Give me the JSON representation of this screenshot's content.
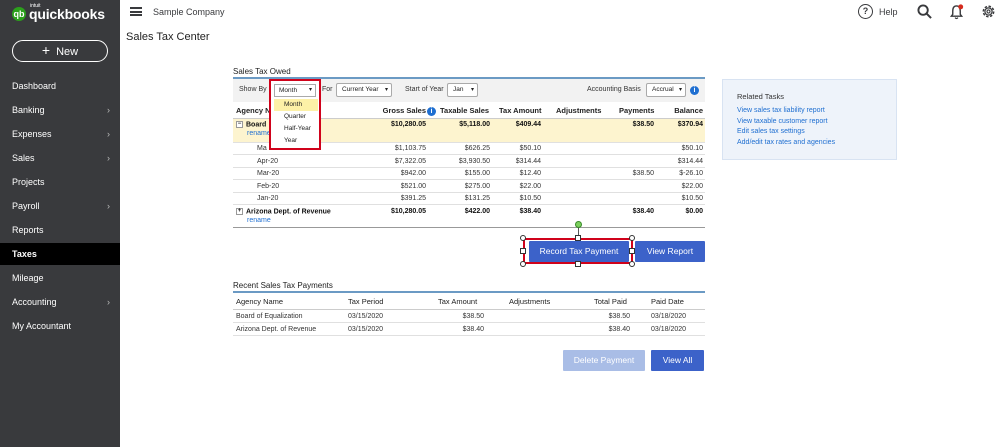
{
  "app": {
    "logo_small": "intuit",
    "logo_text": "quickbooks",
    "logo_mark": "qb"
  },
  "sidebar": {
    "new_label": "New",
    "items": [
      {
        "label": "Dashboard",
        "chevron": false
      },
      {
        "label": "Banking",
        "chevron": true
      },
      {
        "label": "Expenses",
        "chevron": true
      },
      {
        "label": "Sales",
        "chevron": true
      },
      {
        "label": "Projects",
        "chevron": false
      },
      {
        "label": "Payroll",
        "chevron": true
      },
      {
        "label": "Reports",
        "chevron": false
      },
      {
        "label": "Taxes",
        "chevron": false,
        "active": true
      },
      {
        "label": "Mileage",
        "chevron": false
      },
      {
        "label": "Accounting",
        "chevron": true
      },
      {
        "label": "My Accountant",
        "chevron": false
      }
    ]
  },
  "topbar": {
    "company": "Sample Company",
    "help_label": "Help",
    "help_glyph": "?"
  },
  "page_title": "Sales Tax Center",
  "owed": {
    "section_title": "Sales Tax Owed",
    "show_by_label": "Show By",
    "show_by_value": "Month",
    "for_label": "For",
    "for_value": "Current Year",
    "start_label": "Start of Year",
    "start_value": "Jan",
    "basis_label": "Accounting Basis",
    "basis_value": "Accrual",
    "columns": [
      "Agency N",
      "Gross Sales",
      "Taxable Sales",
      "Tax Amount",
      "Adjustments",
      "Payments",
      "Balance"
    ],
    "agency1": {
      "name": "Board",
      "rename": "rename",
      "gross": "$10,280.05",
      "taxable": "$5,118.00",
      "tax": "$409.44",
      "adjustments": "",
      "payments": "$38.50",
      "balance": "$370.94"
    },
    "months": [
      {
        "period": "Ma",
        "gross": "$1,103.75",
        "taxable": "$626.25",
        "tax": "$50.10",
        "adjustments": "",
        "payments": "",
        "balance": "$50.10"
      },
      {
        "period": "Apr-20",
        "gross": "$7,322.05",
        "taxable": "$3,930.50",
        "tax": "$314.44",
        "adjustments": "",
        "payments": "",
        "balance": "$314.44"
      },
      {
        "period": "Mar-20",
        "gross": "$942.00",
        "taxable": "$155.00",
        "tax": "$12.40",
        "adjustments": "",
        "payments": "$38.50",
        "balance": "$-26.10"
      },
      {
        "period": "Feb-20",
        "gross": "$521.00",
        "taxable": "$275.00",
        "tax": "$22.00",
        "adjustments": "",
        "payments": "",
        "balance": "$22.00"
      },
      {
        "period": "Jan-20",
        "gross": "$391.25",
        "taxable": "$131.25",
        "tax": "$10.50",
        "adjustments": "",
        "payments": "",
        "balance": "$10.50"
      }
    ],
    "agency2": {
      "name": "Arizona Dept. of Revenue",
      "rename": "rename",
      "gross": "$10,280.05",
      "taxable": "$422.00",
      "tax": "$38.40",
      "adjustments": "",
      "payments": "$38.40",
      "balance": "$0.00"
    },
    "dropdown": {
      "selected": "Month",
      "options": [
        "Month",
        "Quarter",
        "Half-Year",
        "Year"
      ]
    }
  },
  "buttons": {
    "record": "Record Tax Payment",
    "view_report": "View Report",
    "delete_payment": "Delete Payment",
    "view_all": "View All"
  },
  "recent": {
    "section_title": "Recent Sales Tax Payments",
    "columns": [
      "Agency Name",
      "Tax Period",
      "Tax Amount",
      "Adjustments",
      "Total Paid",
      "Paid Date"
    ],
    "rows": [
      {
        "agency": "Board of Equalization",
        "period": "03/15/2020",
        "tax": "$38.50",
        "adjustments": "",
        "total": "$38.50",
        "paid": "03/18/2020"
      },
      {
        "agency": "Arizona Dept. of Revenue",
        "period": "03/15/2020",
        "tax": "$38.40",
        "adjustments": "",
        "total": "$38.40",
        "paid": "03/18/2020"
      }
    ]
  },
  "related": {
    "title": "Related Tasks",
    "tasks": [
      "View sales tax liability report",
      "View taxable customer report",
      "Edit sales tax settings",
      "Add/edit tax rates and agencies"
    ]
  },
  "colors": {
    "sidebar": "#393a3d",
    "brand_green": "#2ca01c",
    "primary_button": "#3c62c9",
    "highlight_row": "#fdf4cf",
    "annotation_red": "#d0021b"
  },
  "icons": [
    "hamburger-icon",
    "help-icon",
    "search-icon",
    "bell-icon",
    "gear-icon",
    "info-icon",
    "chevron-right-icon",
    "expand-icon"
  ]
}
